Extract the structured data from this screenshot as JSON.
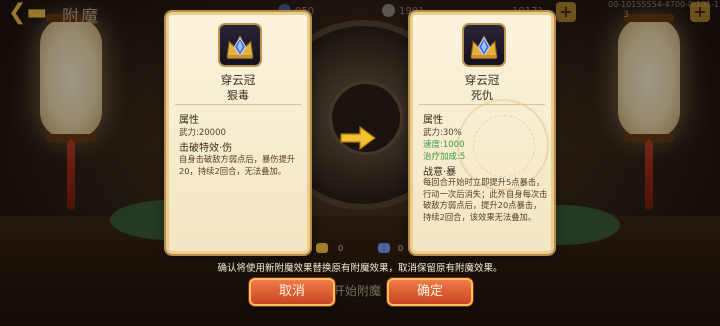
{
  "header": {
    "title": "附魔",
    "resource_1": "950",
    "resource_2": "1991",
    "resource_3": "10171",
    "user_id": "00-10155554-4700-0-101-1",
    "small_count": "3"
  },
  "old_enchant": {
    "item_name": "穿云冠",
    "enchant_name": "狠毒",
    "stat_heading": "属性",
    "stats": [
      {
        "text": "武力:20000",
        "color": "normal"
      }
    ],
    "effect_title": "击破特效·伤",
    "effect_text": "自身击破敌方弱点后，暴伤提升20，持续2回合，无法叠加。"
  },
  "new_enchant": {
    "item_name": "穿云冠",
    "enchant_name": "死仇",
    "stat_heading": "属性",
    "stats": [
      {
        "text": "武力:30%",
        "color": "normal"
      },
      {
        "text": "速度:1000",
        "color": "green"
      },
      {
        "text": "治疗加成:5",
        "color": "green"
      }
    ],
    "effect_title": "战意·暴",
    "effect_text": "每回合开始时立即提升5点暴击，行动一次后消失；此外自身每次击破敌方弱点后，提升20点暴击，持续2回合，该效果无法叠加。"
  },
  "dialog": {
    "message": "确认将使用新附魔效果替换原有附魔效果，取消保留原有附魔效果。",
    "cancel_label": "取消",
    "ok_label": "确定",
    "start_hint": "开始附魔",
    "cost_1": "0",
    "cost_2": "0"
  },
  "colors": {
    "button_fill": "#e0602f",
    "button_border": "#f7c35c",
    "card_bg": "#fbf3dc",
    "stat_green": "#3a9a3e",
    "arrow": "#f2c030"
  },
  "icons": {
    "item": "crown-gem-icon",
    "back": "back-arrow-icon",
    "transfer": "right-arrow-icon"
  }
}
